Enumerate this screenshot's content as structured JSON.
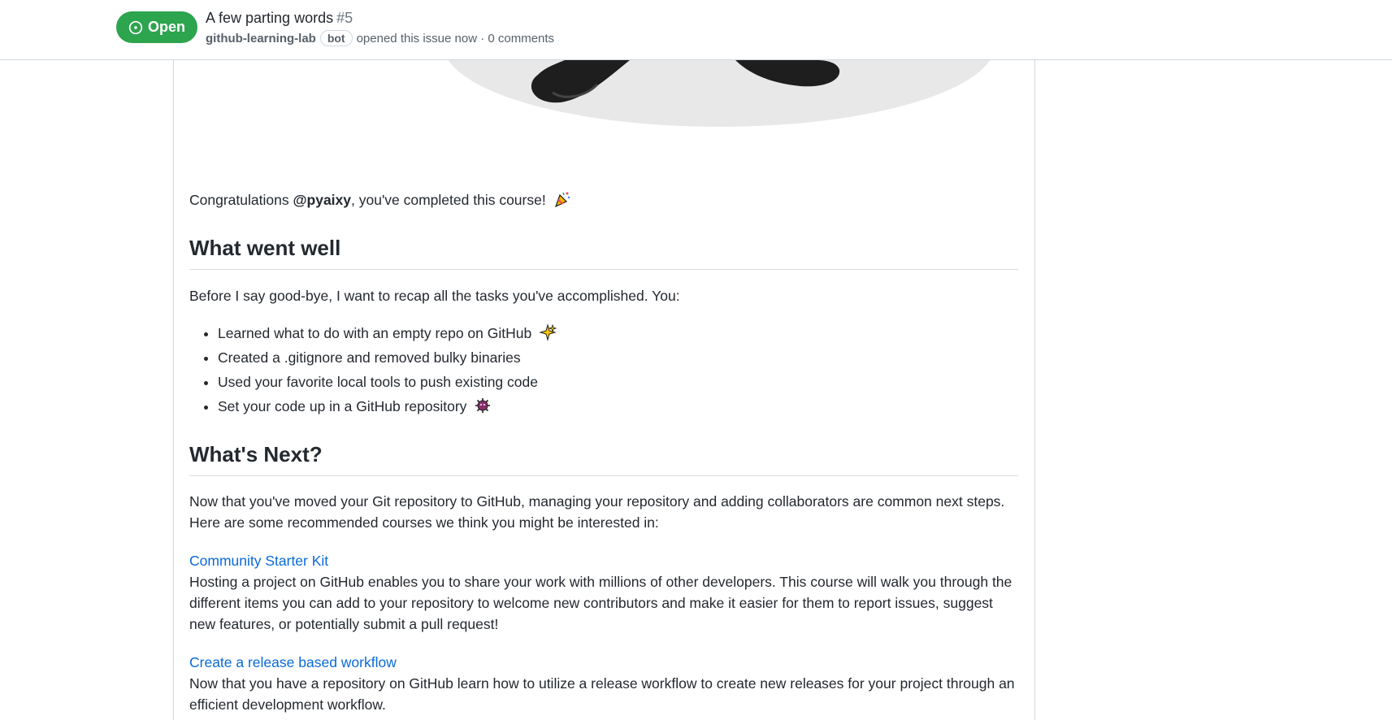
{
  "header": {
    "state_label": "Open",
    "title": "A few parting words",
    "number": "#5",
    "author": "github-learning-lab",
    "author_badge": "bot",
    "meta_text": "opened this issue now · 0 comments"
  },
  "body": {
    "congrats_prefix": "Congratulations ",
    "mention": "@pyaixy",
    "congrats_suffix": ", you've completed this course!",
    "h_went_well": "What went well",
    "recap": "Before I say good-bye, I want to recap all the tasks you've accomplished. You:",
    "tasks": [
      {
        "text": "Learned what to do with an empty repo on GitHub",
        "emoji": "sparkles-icon"
      },
      {
        "text": "Created a .gitignore and removed bulky binaries",
        "emoji": ""
      },
      {
        "text": "Used your favorite local tools to push existing code",
        "emoji": ""
      },
      {
        "text": "Set your code up in a GitHub repository",
        "emoji": "octocat-icon"
      }
    ],
    "h_whats_next": "What's Next?",
    "next_intro": "Now that you've moved your Git repository to GitHub, managing your repository and adding collaborators are common next steps. Here are some recommended courses we think you might be interested in:",
    "courses": [
      {
        "title": "Community Starter Kit",
        "description": "Hosting a project on GitHub enables you to share your work with millions of other developers. This course will walk you through the different items you can add to your repository to welcome new contributors and make it easier for them to report issues, suggest new features, or potentially submit a pull request!"
      },
      {
        "title": "Create a release based workflow",
        "description": "Now that you have a repository on GitHub learn how to utilize a release workflow to create new releases for your project through an efficient development workflow."
      }
    ]
  },
  "colors": {
    "open_green": "#2da44e",
    "link_blue": "#0969da",
    "text": "#24292f",
    "muted": "#57606a"
  }
}
